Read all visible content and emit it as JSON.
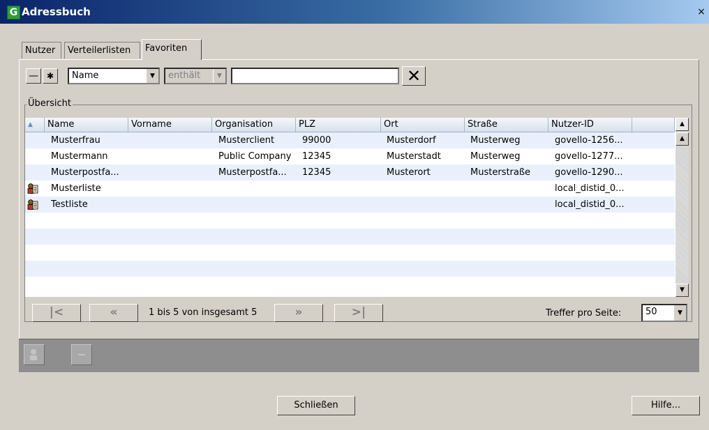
{
  "window": {
    "title": "Adressbuch",
    "logo_letter": "G",
    "close_glyph": "×"
  },
  "tabs": [
    {
      "label": "Nutzer"
    },
    {
      "label": "Verteilerlisten"
    },
    {
      "label": "Favoriten",
      "active": true
    }
  ],
  "filter": {
    "remove_label": "—",
    "add_label": "✱",
    "field_value": "Name",
    "operator_value": "enthält",
    "search_value": "",
    "clear_label": "✕"
  },
  "overview": {
    "legend": "Übersicht",
    "sort_indicator": "▲",
    "columns": [
      "Name",
      "Vorname",
      "Organisation",
      "PLZ",
      "Ort",
      "Straße",
      "Nutzer-ID"
    ],
    "rows": [
      {
        "name": "Musterfrau",
        "vorname": "",
        "organisation": "Musterclient",
        "plz": "99000",
        "ort": "Musterdorf",
        "strasse": "Musterweg",
        "nutzer_id": "govello-1256..."
      },
      {
        "name": "Mustermann",
        "vorname": "",
        "organisation": "Public Company",
        "plz": "12345",
        "ort": "Musterstadt",
        "strasse": "Musterweg",
        "nutzer_id": "govello-1277..."
      },
      {
        "name": "Musterpostfa...",
        "vorname": "",
        "organisation": "Musterpostfa...",
        "plz": "12345",
        "ort": "Musterort",
        "strasse": "Musterstraße",
        "nutzer_id": "govello-1290..."
      },
      {
        "name": "Musterliste",
        "vorname": "",
        "organisation": "",
        "plz": "",
        "ort": "",
        "strasse": "",
        "nutzer_id": "local_distid_0...",
        "icon": "distribution-list-icon"
      },
      {
        "name": "Testliste",
        "vorname": "",
        "organisation": "",
        "plz": "",
        "ort": "",
        "strasse": "",
        "nutzer_id": "local_distid_0...",
        "icon": "distribution-list-icon"
      }
    ]
  },
  "pagination": {
    "first_label": "|<",
    "prev_label": "«",
    "status": "1 bis 5 von insgesamt 5",
    "next_label": "»",
    "last_label": ">|",
    "per_page_label": "Treffer pro Seite:",
    "per_page_value": "50"
  },
  "footer": {
    "close_label": "Schließen",
    "help_label": "Hilfe..."
  },
  "colors": {
    "title_start": "#0a246a",
    "title_end": "#a6caf0",
    "row_alt": "#eaf0fb",
    "action_bar": "#8e8e8e"
  }
}
